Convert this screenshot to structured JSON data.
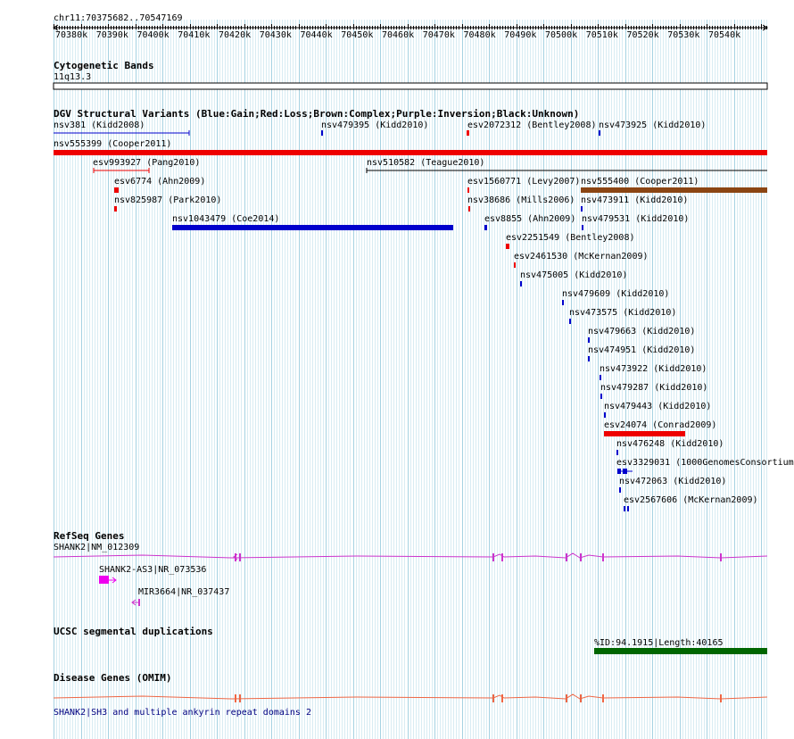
{
  "browser": {
    "position_label": "chr11:70375682..70547169",
    "ruler_ticks": [
      "70380k",
      "70390k",
      "70400k",
      "70410k",
      "70420k",
      "70430k",
      "70440k",
      "70450k",
      "70460k",
      "70470k",
      "70480k",
      "70490k",
      "70500k",
      "70510k",
      "70520k",
      "70530k",
      "70540k"
    ]
  },
  "tracks": {
    "cytoband": {
      "title": "Cytogenetic Bands",
      "band_label": "11q13.3"
    },
    "dgv": {
      "title": "DGV Structural Variants (Blue:Gain;Red:Loss;Brown:Complex;Purple:Inversion;Black:Unknown)",
      "features": [
        {
          "label": "nsv381 (Kidd2008)",
          "color": "#0000cc"
        },
        {
          "label": "nsv479395 (Kidd2010)",
          "color": "#0000cc"
        },
        {
          "label": "esv2072312 (Bentley2008)",
          "color": "#ee0000"
        },
        {
          "label": "nsv473925 (Kidd2010)",
          "color": "#0000cc"
        },
        {
          "label": "nsv555399 (Cooper2011)",
          "color": "#ee0000"
        },
        {
          "label": "esv993927 (Pang2010)",
          "color": "#ee0000"
        },
        {
          "label": "nsv510582 (Teague2010)",
          "color": "#000000"
        },
        {
          "label": "esv6774 (Ahn2009)",
          "color": "#ee0000"
        },
        {
          "label": "esv1560771 (Levy2007)",
          "color": "#ee0000"
        },
        {
          "label": "nsv555400 (Cooper2011)",
          "color": "#8b4513"
        },
        {
          "label": "nsv825987 (Park2010)",
          "color": "#ee0000"
        },
        {
          "label": "nsv38686 (Mills2006)",
          "color": "#ee0000"
        },
        {
          "label": "nsv473911 (Kidd2010)",
          "color": "#0000cc"
        },
        {
          "label": "nsv1043479 (Coe2014)",
          "color": "#0000cc"
        },
        {
          "label": "esv8855 (Ahn2009)",
          "color": "#0000cc"
        },
        {
          "label": "nsv479531 (Kidd2010)",
          "color": "#0000cc"
        },
        {
          "label": "esv2251549 (Bentley2008)",
          "color": "#ee0000"
        },
        {
          "label": "esv2461530 (McKernan2009)",
          "color": "#ee0000"
        },
        {
          "label": "nsv475005 (Kidd2010)",
          "color": "#0000cc"
        },
        {
          "label": "nsv479609 (Kidd2010)",
          "color": "#0000cc"
        },
        {
          "label": "nsv473575 (Kidd2010)",
          "color": "#0000cc"
        },
        {
          "label": "nsv479663 (Kidd2010)",
          "color": "#0000cc"
        },
        {
          "label": "nsv474951 (Kidd2010)",
          "color": "#0000cc"
        },
        {
          "label": "nsv473922 (Kidd2010)",
          "color": "#0000cc"
        },
        {
          "label": "nsv479287 (Kidd2010)",
          "color": "#0000cc"
        },
        {
          "label": "nsv479443 (Kidd2010)",
          "color": "#0000cc"
        },
        {
          "label": "esv24074 (Conrad2009)",
          "color": "#ee0000"
        },
        {
          "label": "nsv476248 (Kidd2010)",
          "color": "#0000cc"
        },
        {
          "label": "esv3329031 (1000GenomesConsortium",
          "color": "#0000cc"
        },
        {
          "label": "nsv472063 (Kidd2010)",
          "color": "#0000cc"
        },
        {
          "label": "esv2567606 (McKernan2009)",
          "color": "#0000cc"
        }
      ]
    },
    "refseq": {
      "title": "RefSeq Genes",
      "genes": [
        {
          "label": "SHANK2|NM_012309",
          "color": "#cc33cc"
        },
        {
          "label": "SHANK2-AS3|NR_073536",
          "color": "#ee00ee"
        },
        {
          "label": "MIR3664|NR_037437",
          "color": "#cc33cc"
        }
      ]
    },
    "segdups": {
      "title": "UCSC segmental duplications",
      "feature_label": "%ID:94.1915|Length:40165",
      "color": "#006600"
    },
    "omim": {
      "title": "Disease Genes (OMIM)",
      "gene_label": "SHANK2|SH3 and multiple ankyrin repeat domains 2",
      "color": "#ee6644"
    }
  }
}
